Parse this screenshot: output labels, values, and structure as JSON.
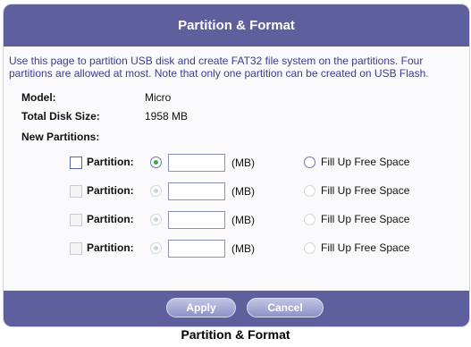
{
  "header": {
    "title": "Partition & Format"
  },
  "intro_text": "Use this page to partition USB disk and create FAT32 file system on the partitions. Four partitions are allowed at most. Note that only one partition can be created on USB Flash.",
  "info": {
    "model_label": "Model:",
    "model_value": "Micro",
    "total_size_label": "Total Disk Size:",
    "total_size_value": "1958 MB",
    "new_partitions_label": "New Partitions:"
  },
  "partitions": [
    {
      "label": "Partition:",
      "unit": "(MB)",
      "fill_label": "Fill Up Free Space",
      "size_value": "",
      "enabled": true
    },
    {
      "label": "Partition:",
      "unit": "(MB)",
      "fill_label": "Fill Up Free Space",
      "size_value": "",
      "enabled": false
    },
    {
      "label": "Partition:",
      "unit": "(MB)",
      "fill_label": "Fill Up Free Space",
      "size_value": "",
      "enabled": false
    },
    {
      "label": "Partition:",
      "unit": "(MB)",
      "fill_label": "Fill Up Free Space",
      "size_value": "",
      "enabled": false
    }
  ],
  "buttons": {
    "apply": "Apply",
    "cancel": "Cancel"
  },
  "caption": "Partition & Format",
  "colors": {
    "header_bg": "#5e5f9c",
    "intro_text": "#3a3d8a",
    "button": "#9fa3d4"
  }
}
